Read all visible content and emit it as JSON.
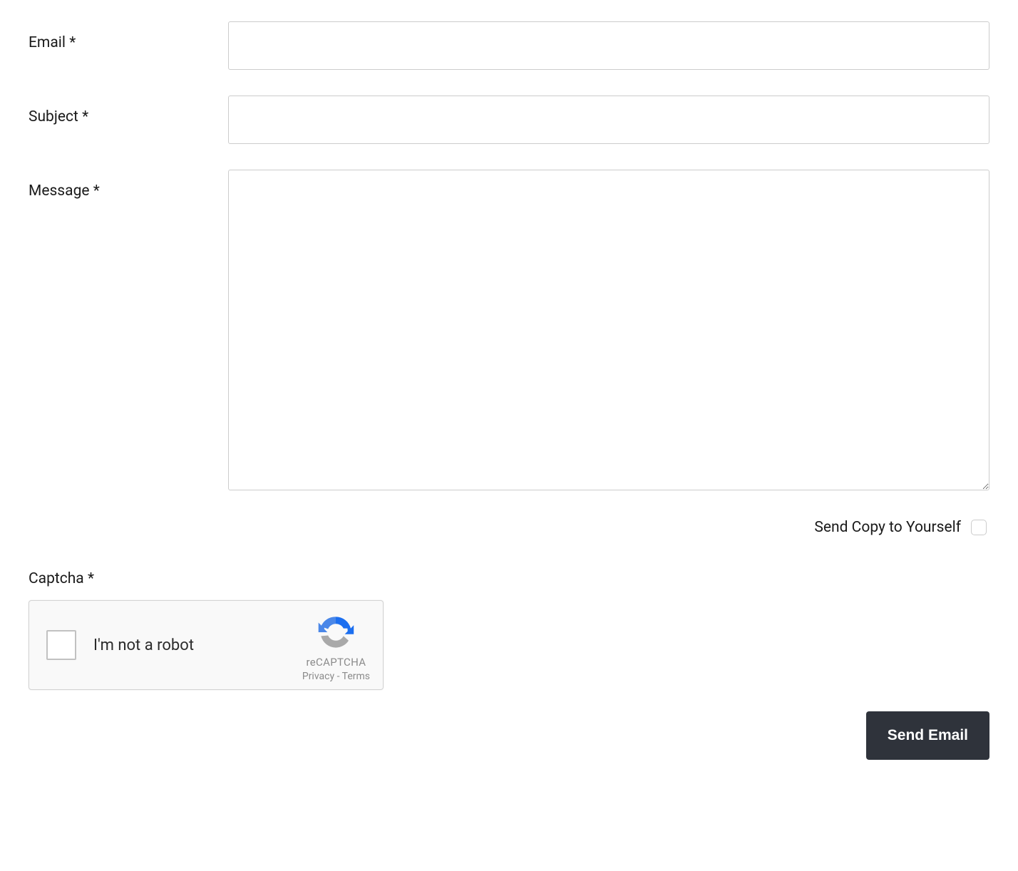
{
  "form": {
    "email": {
      "label": "Email *",
      "value": ""
    },
    "subject": {
      "label": "Subject *",
      "value": ""
    },
    "message": {
      "label": "Message *",
      "value": ""
    },
    "sendCopy": {
      "label": "Send Copy to Yourself"
    },
    "captcha": {
      "label": "Captcha *",
      "notRobot": "I'm not a robot",
      "brand": "reCAPTCHA",
      "privacy": "Privacy",
      "separator": " - ",
      "terms": "Terms"
    },
    "submit": {
      "label": "Send Email"
    }
  }
}
